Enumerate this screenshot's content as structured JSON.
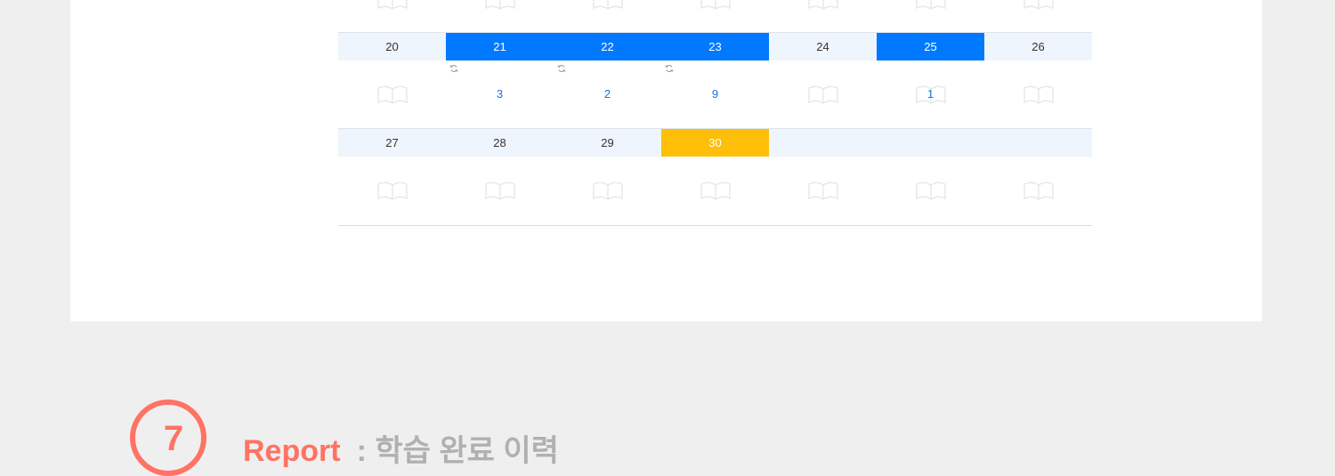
{
  "calendar": {
    "weeks": [
      {
        "days": [
          {
            "label": "20",
            "state": "normal",
            "count": "",
            "repeat": false
          },
          {
            "label": "21",
            "state": "active",
            "count": "3",
            "repeat": true
          },
          {
            "label": "22",
            "state": "active",
            "count": "2",
            "repeat": true
          },
          {
            "label": "23",
            "state": "active",
            "count": "9",
            "repeat": true
          },
          {
            "label": "24",
            "state": "normal",
            "count": "",
            "repeat": false
          },
          {
            "label": "25",
            "state": "active",
            "count": "1",
            "repeat": false
          },
          {
            "label": "26",
            "state": "normal",
            "count": "",
            "repeat": false
          }
        ]
      },
      {
        "days": [
          {
            "label": "27",
            "state": "normal",
            "count": "",
            "repeat": false
          },
          {
            "label": "28",
            "state": "normal",
            "count": "",
            "repeat": false
          },
          {
            "label": "29",
            "state": "normal",
            "count": "",
            "repeat": false
          },
          {
            "label": "30",
            "state": "today",
            "count": "",
            "repeat": false
          },
          {
            "label": "",
            "state": "empty",
            "count": "",
            "repeat": false
          },
          {
            "label": "",
            "state": "empty",
            "count": "",
            "repeat": false
          },
          {
            "label": "",
            "state": "empty",
            "count": "",
            "repeat": false
          }
        ]
      }
    ]
  },
  "section": {
    "number": "7",
    "title_en": "Report",
    "title_ko": ": 학습 완료 이력"
  },
  "colors": {
    "active_day": "#0079ff",
    "today": "#ffbf08",
    "count_text": "#1a73e8",
    "accent": "#ff7264"
  }
}
